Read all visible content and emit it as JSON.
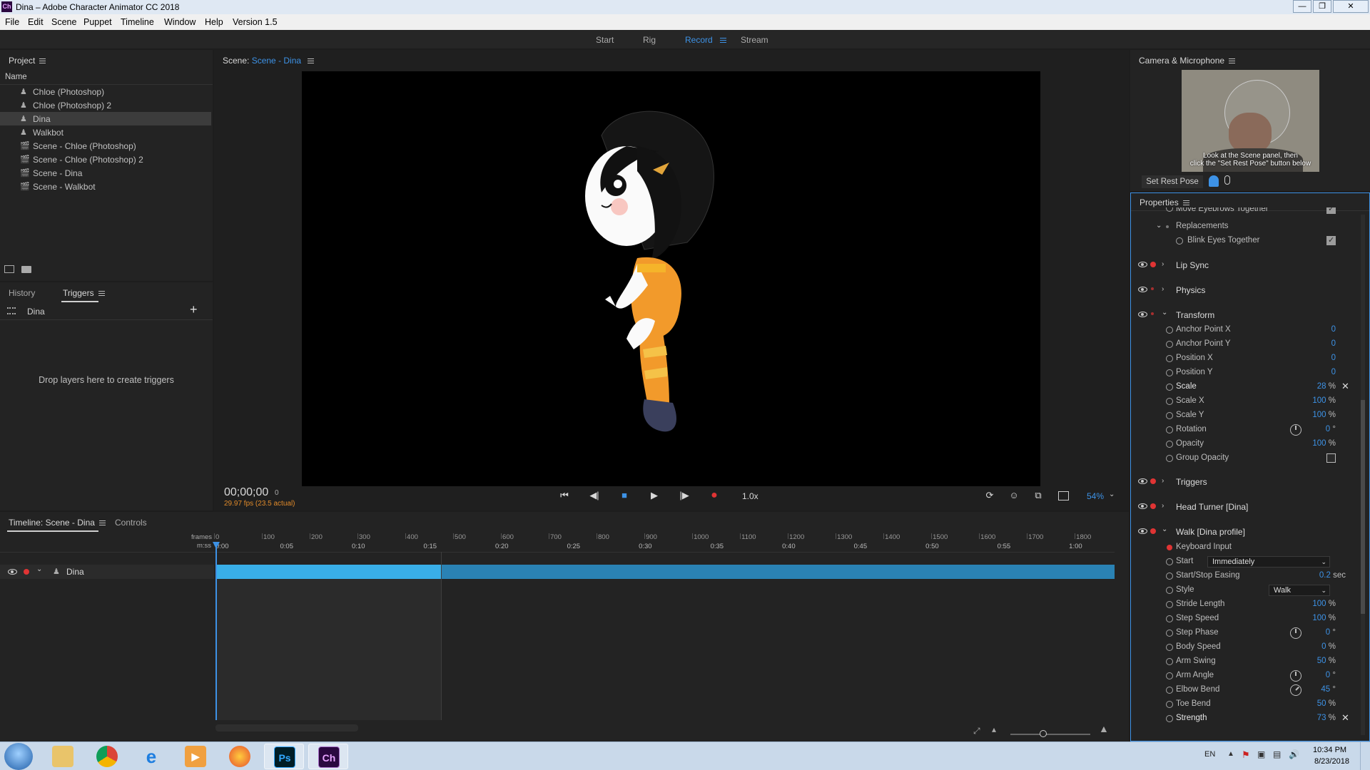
{
  "window": {
    "app_icon": "Ch",
    "title": "Dina – Adobe Character Animator CC 2018"
  },
  "menu": [
    "File",
    "Edit",
    "Scene",
    "Puppet",
    "Timeline",
    "Window",
    "Help",
    "Version 1.5"
  ],
  "workspaces": {
    "start": "Start",
    "rig": "Rig",
    "record": "Record",
    "stream": "Stream",
    "active": "Record"
  },
  "project": {
    "title": "Project",
    "column": "Name",
    "items": [
      {
        "label": "Chloe (Photoshop)",
        "icon": "puppet-icon"
      },
      {
        "label": "Chloe (Photoshop) 2",
        "icon": "puppet-icon"
      },
      {
        "label": "Dina",
        "icon": "puppet-icon",
        "selected": true
      },
      {
        "label": "Walkbot",
        "icon": "puppet-icon"
      },
      {
        "label": "Scene - Chloe (Photoshop)",
        "icon": "scene-icon"
      },
      {
        "label": "Scene - Chloe (Photoshop) 2",
        "icon": "scene-icon"
      },
      {
        "label": "Scene - Dina",
        "icon": "scene-icon"
      },
      {
        "label": "Scene - Walkbot",
        "icon": "scene-icon"
      }
    ]
  },
  "triggers_panel": {
    "tab_history": "History",
    "tab_triggers": "Triggers",
    "puppet": "Dina",
    "empty_text": "Drop layers here to create triggers"
  },
  "scene": {
    "label": "Scene:",
    "name": "Scene - Dina"
  },
  "transport": {
    "timecode": "00;00;00",
    "frame": "0",
    "fps": "29.97 fps (23.5 actual)",
    "speed": "1.0x",
    "zoom": "54%"
  },
  "camera": {
    "title": "Camera & Microphone",
    "hint_line1": "Look at the Scene panel, then",
    "hint_line2": "click the \"Set Rest Pose\" button below",
    "set_rest_pose": "Set Rest Pose"
  },
  "properties": {
    "title": "Properties",
    "partial_top": "Move Eyebrows Together",
    "replacements": "Replacements",
    "blink": "Blink Eyes Together",
    "groups": {
      "lip_sync": "Lip Sync",
      "physics": "Physics",
      "transform": "Transform",
      "triggers": "Triggers",
      "head_turner": "Head Turner [Dina]",
      "walk": "Walk [Dina profile]"
    },
    "transform": [
      {
        "name": "Anchor Point X",
        "value": "0",
        "unit": ""
      },
      {
        "name": "Anchor Point Y",
        "value": "0",
        "unit": ""
      },
      {
        "name": "Position X",
        "value": "0",
        "unit": ""
      },
      {
        "name": "Position Y",
        "value": "0",
        "unit": ""
      },
      {
        "name": "Scale",
        "value": "28",
        "unit": " %"
      },
      {
        "name": "Scale X",
        "value": "100",
        "unit": " %"
      },
      {
        "name": "Scale Y",
        "value": "100",
        "unit": " %"
      },
      {
        "name": "Rotation",
        "value": "0",
        "unit": " °"
      },
      {
        "name": "Opacity",
        "value": "100",
        "unit": " %"
      },
      {
        "name": "Group Opacity",
        "value": "",
        "unit": ""
      }
    ],
    "walk": {
      "keyboard_input": "Keyboard Input",
      "start_label": "Start",
      "start_value": "Immediately",
      "easing_label": "Start/Stop Easing",
      "easing_value": "0.2",
      "easing_unit": " sec",
      "style_label": "Style",
      "style_value": "Walk",
      "params": [
        {
          "name": "Stride Length",
          "value": "100",
          "unit": " %"
        },
        {
          "name": "Step Speed",
          "value": "100",
          "unit": " %"
        },
        {
          "name": "Step Phase",
          "value": "0",
          "unit": " °"
        },
        {
          "name": "Body Speed",
          "value": "0",
          "unit": " %"
        },
        {
          "name": "Arm Swing",
          "value": "50",
          "unit": " %"
        },
        {
          "name": "Arm Angle",
          "value": "0",
          "unit": " °"
        },
        {
          "name": "Elbow Bend",
          "value": "45",
          "unit": " °"
        },
        {
          "name": "Toe Bend",
          "value": "50",
          "unit": " %"
        },
        {
          "name": "Strength",
          "value": "73",
          "unit": " %"
        }
      ]
    }
  },
  "timeline": {
    "tab": "Timeline: Scene - Dina",
    "controls_tab": "Controls",
    "frames_label": "frames",
    "mss_label": "m:ss",
    "frame_ticks": [
      "0",
      "100",
      "200",
      "300",
      "400",
      "500",
      "600",
      "700",
      "800",
      "900",
      "1000",
      "1100",
      "1200",
      "1300",
      "1400",
      "1500",
      "1600",
      "1700",
      "1800"
    ],
    "time_ticks": [
      "0:00",
      "0:05",
      "0:10",
      "0:15",
      "0:20",
      "0:25",
      "0:30",
      "0:35",
      "0:40",
      "0:45",
      "0:50",
      "0:55",
      "1:00"
    ],
    "track": "Dina"
  },
  "taskbar": {
    "lang": "EN",
    "time": "10:34 PM",
    "date": "8/23/2018",
    "apps": [
      "start-orb",
      "explorer",
      "chrome",
      "ie",
      "media-player",
      "firefox",
      "photoshop",
      "character-animator"
    ],
    "ps": "Ps",
    "ch": "Ch"
  },
  "colors": {
    "accent": "#3d92e6",
    "record_red": "#e03434",
    "track_blue": "#39aee8",
    "fps_orange": "#e08a2a"
  }
}
